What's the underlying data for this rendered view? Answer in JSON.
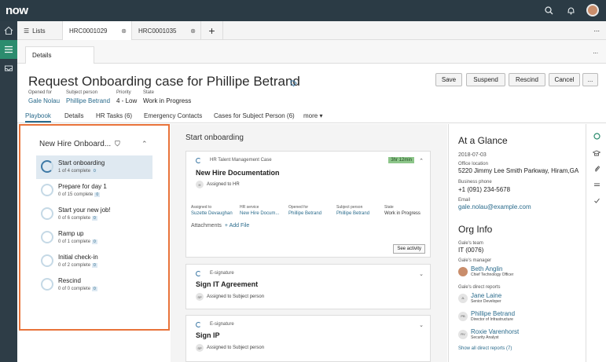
{
  "topbar": {
    "logo": "now"
  },
  "tabs": {
    "lists": "Lists",
    "tab1": "HRC0001029",
    "tab2": "HRC0001035",
    "plus": "+",
    "more": "..."
  },
  "subtabs": {
    "details": "Details",
    "more": "..."
  },
  "record": {
    "title": "Request Onboarding case for Phillipe Betrand",
    "opened_for_label": "Opened for",
    "opened_for": "Gale Nolau",
    "subject_person_label": "Subject person",
    "subject_person": "Phillipe Betrand",
    "priority_label": "Priority",
    "priority": "4 - Low",
    "state_label": "State",
    "state": "Work in Progress"
  },
  "actions": {
    "save": "Save",
    "suspend": "Suspend",
    "rescind": "Rescind",
    "cancel": "Cancel",
    "more": "..."
  },
  "form_tabs": [
    "Playbook",
    "Details",
    "HR Tasks (6)",
    "Emergency Contacts",
    "Cases for Subject Person (6)",
    "more ▾"
  ],
  "playbook": {
    "title": "New Hire Onboard...",
    "steps": [
      {
        "label": "Start onboarding",
        "count": "1 of 4 complete",
        "badge": "0"
      },
      {
        "label": "Prepare for day 1",
        "count": "0 of 15 complete",
        "badge": "0"
      },
      {
        "label": "Start your new job!",
        "count": "0 of 6 complete",
        "badge": "0"
      },
      {
        "label": "Ramp up",
        "count": "0 of 1 complete",
        "badge": "0"
      },
      {
        "label": "Initial check-in",
        "count": "0 of 2 complete",
        "badge": "0"
      },
      {
        "label": "Rescind",
        "count": "0 of 0 complete",
        "badge": "0"
      }
    ]
  },
  "activity": {
    "section_title": "Start onboarding",
    "card1": {
      "category": "HR Talent Management Case",
      "timer": "3hr 12min",
      "title": "New Hire Documentation",
      "assign_badge": "H",
      "assigned": "Assigned to HR",
      "assigned_to_label": "Assigned to",
      "assigned_to": "Suzette Devaughan",
      "hr_service_label": "HR service",
      "hr_service": "New Hire Docum...",
      "opened_for_label": "Opened for",
      "opened_for": "Phillipe Betrand",
      "subject_label": "Subject person",
      "subject": "Phillipe Betrand",
      "state_label": "State",
      "state": "Work in Progress",
      "attachments": "Attachments",
      "add_file": "+ Add File",
      "see_activity": "See activity"
    },
    "card2": {
      "category": "E-signature",
      "title": "Sign IT Agreement",
      "assign_badge": "SP",
      "assigned": "Assigned to Subject person"
    },
    "card3": {
      "category": "E-signature",
      "title": "Sign IP",
      "assign_badge": "SP",
      "assigned": "Assigned to Subject person"
    }
  },
  "glance": {
    "title": "At a Glance",
    "date": "2018-07-03",
    "office_label": "Office location",
    "office": "5220 Jimmy Lee Smith Parkway, Hiram,GA",
    "phone_label": "Business phone",
    "phone": "+1 (091) 234-5678",
    "email_label": "Email",
    "email": "gale.nolau@example.com",
    "org_title": "Org Info",
    "team_label": "Gale's team",
    "team": "IT (0076)",
    "manager_label": "Gale's manager",
    "manager": {
      "name": "Beth Anglin",
      "role": "Chief Technology Officer"
    },
    "reports_label": "Gale's direct reports",
    "reports": [
      {
        "initials": "JL",
        "name": "Jane Laine",
        "role": "Senior Developer"
      },
      {
        "initials": "PB",
        "name": "Phillipe Betrand",
        "role": "Director of Infrastructure"
      },
      {
        "initials": "RV",
        "name": "Roxie Varenhorst",
        "role": "Security Analyst"
      }
    ],
    "show_all": "Show all direct reports (7)"
  }
}
